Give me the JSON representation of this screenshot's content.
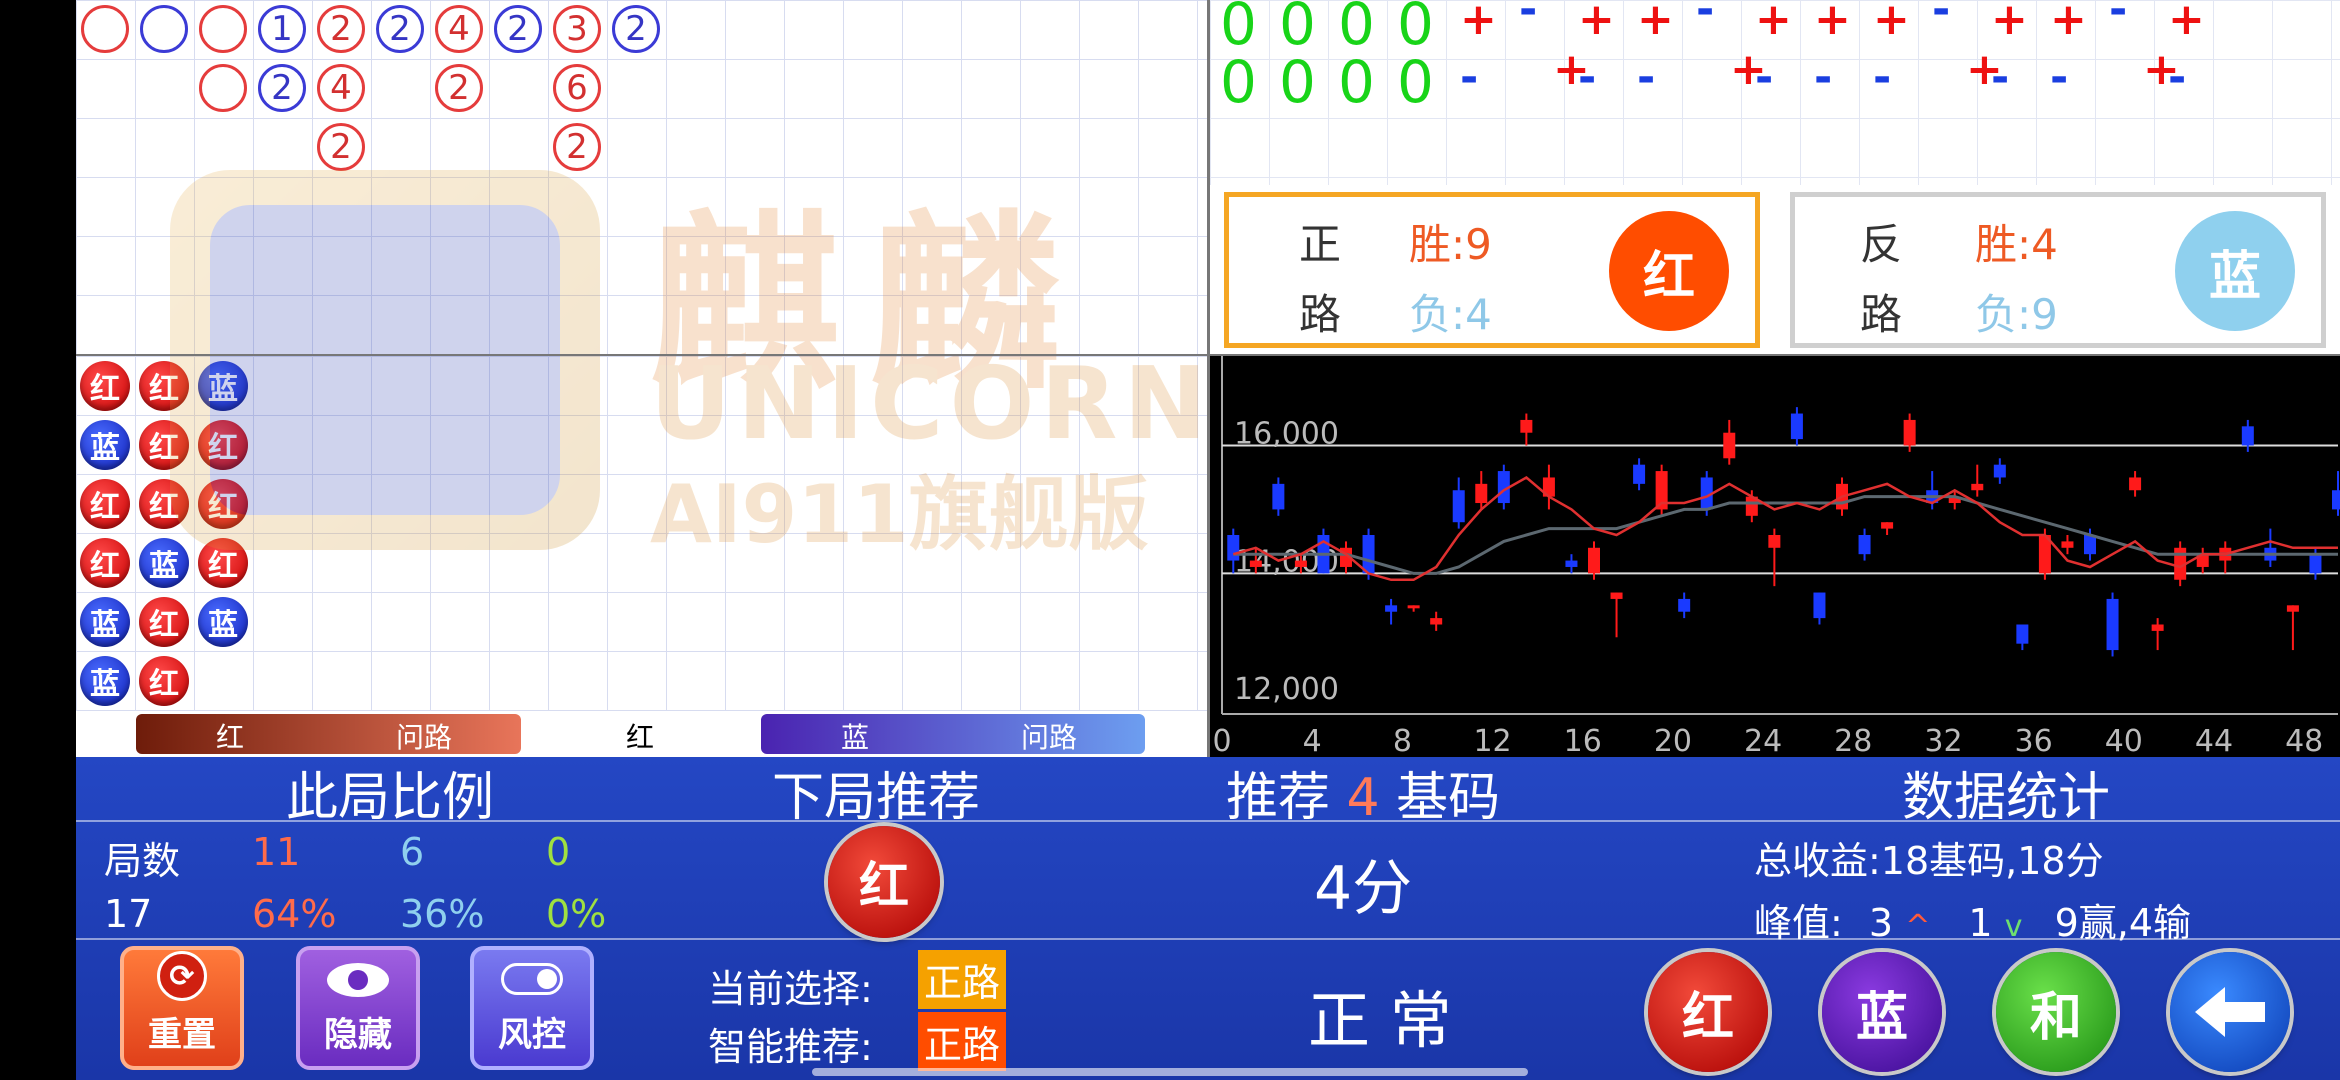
{
  "left_tracks": {
    "red_label": "红",
    "ask_label": "问路",
    "mid_label": "红",
    "blue_label": "蓝",
    "ask_label2": "问路"
  },
  "big_road_circles": [
    {
      "col": 0,
      "row": 0,
      "c": "r",
      "t": ""
    },
    {
      "col": 1,
      "row": 0,
      "c": "b",
      "t": ""
    },
    {
      "col": 2,
      "row": 0,
      "c": "r",
      "t": ""
    },
    {
      "col": 3,
      "row": 0,
      "c": "b",
      "t": "1"
    },
    {
      "col": 4,
      "row": 0,
      "c": "r",
      "t": "2"
    },
    {
      "col": 5,
      "row": 0,
      "c": "b",
      "t": "2"
    },
    {
      "col": 6,
      "row": 0,
      "c": "r",
      "t": "4"
    },
    {
      "col": 7,
      "row": 0,
      "c": "b",
      "t": "2"
    },
    {
      "col": 8,
      "row": 0,
      "c": "r",
      "t": "3"
    },
    {
      "col": 9,
      "row": 0,
      "c": "b",
      "t": "2"
    },
    {
      "col": 2,
      "row": 1,
      "c": "r",
      "t": ""
    },
    {
      "col": 3,
      "row": 1,
      "c": "b",
      "t": "2"
    },
    {
      "col": 4,
      "row": 1,
      "c": "r",
      "t": "4"
    },
    {
      "col": 6,
      "row": 1,
      "c": "r",
      "t": "2"
    },
    {
      "col": 8,
      "row": 1,
      "c": "r",
      "t": "6"
    },
    {
      "col": 4,
      "row": 2,
      "c": "r",
      "t": "2"
    },
    {
      "col": 8,
      "row": 2,
      "c": "r",
      "t": "2"
    }
  ],
  "bead_plate": [
    {
      "col": 0,
      "row": 0,
      "c": "r",
      "t": "红"
    },
    {
      "col": 1,
      "row": 0,
      "c": "r",
      "t": "红"
    },
    {
      "col": 2,
      "row": 0,
      "c": "b",
      "t": "蓝"
    },
    {
      "col": 0,
      "row": 1,
      "c": "b",
      "t": "蓝"
    },
    {
      "col": 1,
      "row": 1,
      "c": "r",
      "t": "红"
    },
    {
      "col": 2,
      "row": 1,
      "c": "r",
      "t": "红"
    },
    {
      "col": 0,
      "row": 2,
      "c": "r",
      "t": "红"
    },
    {
      "col": 1,
      "row": 2,
      "c": "r",
      "t": "红"
    },
    {
      "col": 2,
      "row": 2,
      "c": "r",
      "t": "红"
    },
    {
      "col": 0,
      "row": 3,
      "c": "r",
      "t": "红"
    },
    {
      "col": 1,
      "row": 3,
      "c": "b",
      "t": "蓝"
    },
    {
      "col": 2,
      "row": 3,
      "c": "r",
      "t": "红"
    },
    {
      "col": 0,
      "row": 4,
      "c": "b",
      "t": "蓝"
    },
    {
      "col": 1,
      "row": 4,
      "c": "r",
      "t": "红"
    },
    {
      "col": 2,
      "row": 4,
      "c": "b",
      "t": "蓝"
    },
    {
      "col": 0,
      "row": 5,
      "c": "b",
      "t": "蓝"
    },
    {
      "col": 1,
      "row": 5,
      "c": "r",
      "t": "红"
    }
  ],
  "watermark": {
    "brand_cn": "麒麟",
    "brand_en": "UNICORN",
    "version": "AI911旗舰版"
  },
  "top_right": {
    "zeros_row1": [
      "0",
      "0",
      "0",
      "0"
    ],
    "zeros_row2": [
      "0",
      "0",
      "0",
      "0"
    ],
    "signs_row1": [
      "+",
      "-",
      "+",
      "+",
      "-",
      "+",
      "+",
      "+",
      "-",
      "+",
      "+",
      "-",
      "+"
    ],
    "signs_row2": [
      "-",
      "+",
      "-",
      "-",
      "+",
      "-",
      "-",
      "-",
      "+",
      "-",
      "-",
      "+",
      "-"
    ]
  },
  "road_forward": {
    "line1": "正",
    "line2": "路",
    "win": "胜:9",
    "lose": "负:4",
    "badge": "红"
  },
  "road_reverse": {
    "line1": "反",
    "line2": "路",
    "win": "胜:4",
    "lose": "负:9",
    "badge": "蓝"
  },
  "chart_data": {
    "type": "candlestick",
    "yticks": [
      "12,000",
      "14,000",
      "16,000"
    ],
    "xticks": [
      "0",
      "4",
      "8",
      "12",
      "16",
      "20",
      "24",
      "28",
      "32",
      "36",
      "40",
      "44",
      "48"
    ],
    "ylim": [
      11800,
      17400
    ],
    "xlim": [
      0,
      49.5
    ],
    "upper_line": 16000,
    "lower_line": 14000,
    "candles": [
      {
        "x": 0,
        "o": 14600,
        "c": 14200,
        "h": 14700,
        "l": 14000,
        "color": "b"
      },
      {
        "x": 1,
        "o": 14200,
        "c": 14100,
        "h": 14400,
        "l": 14000,
        "color": "r"
      },
      {
        "x": 2,
        "o": 15400,
        "c": 15000,
        "h": 15500,
        "l": 14900,
        "color": "b"
      },
      {
        "x": 3,
        "o": 14100,
        "c": 14200,
        "h": 14300,
        "l": 14000,
        "color": "r"
      },
      {
        "x": 4,
        "o": 14600,
        "c": 14000,
        "h": 14700,
        "l": 14000,
        "color": "b"
      },
      {
        "x": 5,
        "o": 14400,
        "c": 14100,
        "h": 14500,
        "l": 14000,
        "color": "r"
      },
      {
        "x": 6,
        "o": 14600,
        "c": 14000,
        "h": 14700,
        "l": 13900,
        "color": "b"
      },
      {
        "x": 7,
        "o": 13400,
        "c": 13500,
        "h": 13600,
        "l": 13200,
        "color": "b"
      },
      {
        "x": 8,
        "o": 13500,
        "c": 13500,
        "h": 13500,
        "l": 13400,
        "color": "r"
      },
      {
        "x": 9,
        "o": 13300,
        "c": 13200,
        "h": 13400,
        "l": 13100,
        "color": "r"
      },
      {
        "x": 10,
        "o": 15300,
        "c": 14800,
        "h": 15500,
        "l": 14700,
        "color": "b"
      },
      {
        "x": 11,
        "o": 15100,
        "c": 15400,
        "h": 15600,
        "l": 15000,
        "color": "r"
      },
      {
        "x": 12,
        "o": 15600,
        "c": 15100,
        "h": 15700,
        "l": 15000,
        "color": "b"
      },
      {
        "x": 13,
        "o": 16400,
        "c": 16200,
        "h": 16500,
        "l": 16000,
        "color": "r"
      },
      {
        "x": 14,
        "o": 15200,
        "c": 15500,
        "h": 15700,
        "l": 15000,
        "color": "r"
      },
      {
        "x": 15,
        "o": 14100,
        "c": 14200,
        "h": 14300,
        "l": 14000,
        "color": "b"
      },
      {
        "x": 16,
        "o": 14400,
        "c": 14000,
        "h": 14500,
        "l": 13900,
        "color": "r"
      },
      {
        "x": 17,
        "o": 13700,
        "c": 13600,
        "h": 13700,
        "l": 13000,
        "color": "r"
      },
      {
        "x": 18,
        "o": 15700,
        "c": 15400,
        "h": 15800,
        "l": 15300,
        "color": "b"
      },
      {
        "x": 19,
        "o": 15600,
        "c": 15000,
        "h": 15700,
        "l": 14900,
        "color": "r"
      },
      {
        "x": 20,
        "o": 13600,
        "c": 13400,
        "h": 13700,
        "l": 13300,
        "color": "b"
      },
      {
        "x": 21,
        "o": 15500,
        "c": 15000,
        "h": 15600,
        "l": 14900,
        "color": "b"
      },
      {
        "x": 22,
        "o": 16200,
        "c": 15800,
        "h": 16400,
        "l": 15700,
        "color": "r"
      },
      {
        "x": 23,
        "o": 15200,
        "c": 14900,
        "h": 15300,
        "l": 14800,
        "color": "r"
      },
      {
        "x": 24,
        "o": 14600,
        "c": 14400,
        "h": 14700,
        "l": 13800,
        "color": "r"
      },
      {
        "x": 25,
        "o": 16100,
        "c": 16500,
        "h": 16600,
        "l": 16000,
        "color": "b"
      },
      {
        "x": 26,
        "o": 13700,
        "c": 13300,
        "h": 13700,
        "l": 13200,
        "color": "b"
      },
      {
        "x": 27,
        "o": 15400,
        "c": 15000,
        "h": 15500,
        "l": 14900,
        "color": "r"
      },
      {
        "x": 28,
        "o": 14600,
        "c": 14300,
        "h": 14700,
        "l": 14200,
        "color": "b"
      },
      {
        "x": 29,
        "o": 14800,
        "c": 14700,
        "h": 14800,
        "l": 14600,
        "color": "r"
      },
      {
        "x": 30,
        "o": 16400,
        "c": 16000,
        "h": 16500,
        "l": 15900,
        "color": "r"
      },
      {
        "x": 31,
        "o": 15300,
        "c": 15100,
        "h": 15600,
        "l": 15000,
        "color": "b"
      },
      {
        "x": 32,
        "o": 15200,
        "c": 15100,
        "h": 15300,
        "l": 15000,
        "color": "r"
      },
      {
        "x": 33,
        "o": 15400,
        "c": 15300,
        "h": 15700,
        "l": 15200,
        "color": "r"
      },
      {
        "x": 34,
        "o": 15700,
        "c": 15500,
        "h": 15800,
        "l": 15400,
        "color": "b"
      },
      {
        "x": 35,
        "o": 13200,
        "c": 12900,
        "h": 13200,
        "l": 12800,
        "color": "b"
      },
      {
        "x": 36,
        "o": 14600,
        "c": 14000,
        "h": 14700,
        "l": 13900,
        "color": "r"
      },
      {
        "x": 37,
        "o": 14500,
        "c": 14400,
        "h": 14600,
        "l": 14300,
        "color": "r"
      },
      {
        "x": 38,
        "o": 14600,
        "c": 14300,
        "h": 14700,
        "l": 14200,
        "color": "b"
      },
      {
        "x": 39,
        "o": 13600,
        "c": 12800,
        "h": 13700,
        "l": 12700,
        "color": "b"
      },
      {
        "x": 40,
        "o": 15300,
        "c": 15500,
        "h": 15600,
        "l": 15200,
        "color": "r"
      },
      {
        "x": 41,
        "o": 13200,
        "c": 13100,
        "h": 13300,
        "l": 12800,
        "color": "r"
      },
      {
        "x": 42,
        "o": 14400,
        "c": 13900,
        "h": 14500,
        "l": 13800,
        "color": "r"
      },
      {
        "x": 43,
        "o": 14300,
        "c": 14100,
        "h": 14400,
        "l": 14000,
        "color": "r"
      },
      {
        "x": 44,
        "o": 14400,
        "c": 14200,
        "h": 14500,
        "l": 14000,
        "color": "r"
      },
      {
        "x": 45,
        "o": 16300,
        "c": 16000,
        "h": 16400,
        "l": 15900,
        "color": "b"
      },
      {
        "x": 46,
        "o": 14400,
        "c": 14200,
        "h": 14700,
        "l": 14100,
        "color": "b"
      },
      {
        "x": 47,
        "o": 13500,
        "c": 13400,
        "h": 13500,
        "l": 12800,
        "color": "r"
      },
      {
        "x": 48,
        "o": 14300,
        "c": 14000,
        "h": 14400,
        "l": 13900,
        "color": "b"
      },
      {
        "x": 49,
        "o": 15300,
        "c": 15000,
        "h": 15600,
        "l": 14900,
        "color": "b"
      }
    ],
    "red_line": [
      14300,
      14400,
      14200,
      14300,
      14500,
      14300,
      14000,
      13900,
      13900,
      14100,
      14600,
      15000,
      15300,
      15500,
      15200,
      15000,
      14700,
      14600,
      14800,
      15100,
      15100,
      15200,
      15400,
      15200,
      15000,
      15100,
      15000,
      15200,
      15300,
      15400,
      15200,
      15100,
      15300,
      15100,
      14800,
      14600,
      14600,
      14200,
      14100,
      14300,
      14500,
      14200,
      14100,
      14300,
      14300,
      14400,
      14500,
      14400,
      14400,
      14400
    ],
    "gray_line": [
      14300,
      14300,
      14300,
      14300,
      14300,
      14300,
      14200,
      14100,
      14000,
      14000,
      14100,
      14300,
      14500,
      14600,
      14700,
      14700,
      14700,
      14700,
      14800,
      14900,
      15000,
      15000,
      15100,
      15100,
      15100,
      15100,
      15100,
      15100,
      15200,
      15200,
      15200,
      15200,
      15200,
      15100,
      15000,
      14900,
      14800,
      14700,
      14600,
      14500,
      14400,
      14300,
      14300,
      14300,
      14300,
      14300,
      14300,
      14300,
      14300,
      14300
    ]
  },
  "stats": {
    "header_ratio": "此局比例",
    "header_next": "下局推荐",
    "header_recommend_prefix": "推荐",
    "recommend_num": "4",
    "header_recommend_suffix": "基码",
    "header_data": "数据统计",
    "rounds_label": "局数",
    "red_count": "11",
    "blue_count": "6",
    "tie_count": "0",
    "total": "17",
    "red_pct": "64%",
    "blue_pct": "36%",
    "tie_pct": "0%",
    "next_badge": "红",
    "points": "4分",
    "total_income": "总收益:18基码,18分",
    "peak_label": "峰值:",
    "peak_up": "3",
    "peak_up_sym": "^",
    "peak_down": "1",
    "peak_down_sym": "v",
    "win_lose": "9赢,4输"
  },
  "controls": {
    "reset_label": "重置",
    "hide_label": "隐藏",
    "risk_label": "风控",
    "current_label": "当前选择:",
    "current_value": "正路",
    "smart_label": "智能推荐:",
    "smart_value": "正路",
    "status": "正 常",
    "red_btn": "红",
    "blue_btn": "蓝",
    "tie_btn": "和",
    "back_icon": "arrow-left-icon"
  },
  "colors": {
    "red": "#e53030",
    "blue": "#2b3bd6",
    "green": "#18d418",
    "orange": "#ff4d00",
    "lightblue": "#8fd0ee",
    "bar_blue": "#2447c4"
  }
}
